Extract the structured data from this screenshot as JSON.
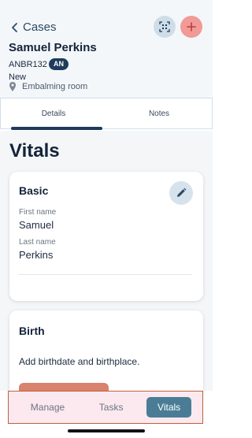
{
  "header": {
    "back_label": "Cases",
    "case_name": "Samuel Perkins",
    "case_id": "ANBR132",
    "badge": "AN",
    "status": "New",
    "location": "Embalming room"
  },
  "tabs": [
    {
      "label": "Details"
    },
    {
      "label": "Notes"
    }
  ],
  "page_title": "Vitals",
  "basic_card": {
    "title": "Basic",
    "first_name_label": "First name",
    "first_name": "Samuel",
    "last_name_label": "Last name",
    "last_name": "Perkins"
  },
  "birth_card": {
    "title": "Birth",
    "text": "Add birthdate and birthplace."
  },
  "bottom_nav": [
    {
      "label": "Manage"
    },
    {
      "label": "Tasks"
    },
    {
      "label": "Vitals"
    }
  ],
  "colors": {
    "primary_dark": "#1f3a5c",
    "accent_add": "#f19a96",
    "active_nav": "#4a7d95"
  }
}
